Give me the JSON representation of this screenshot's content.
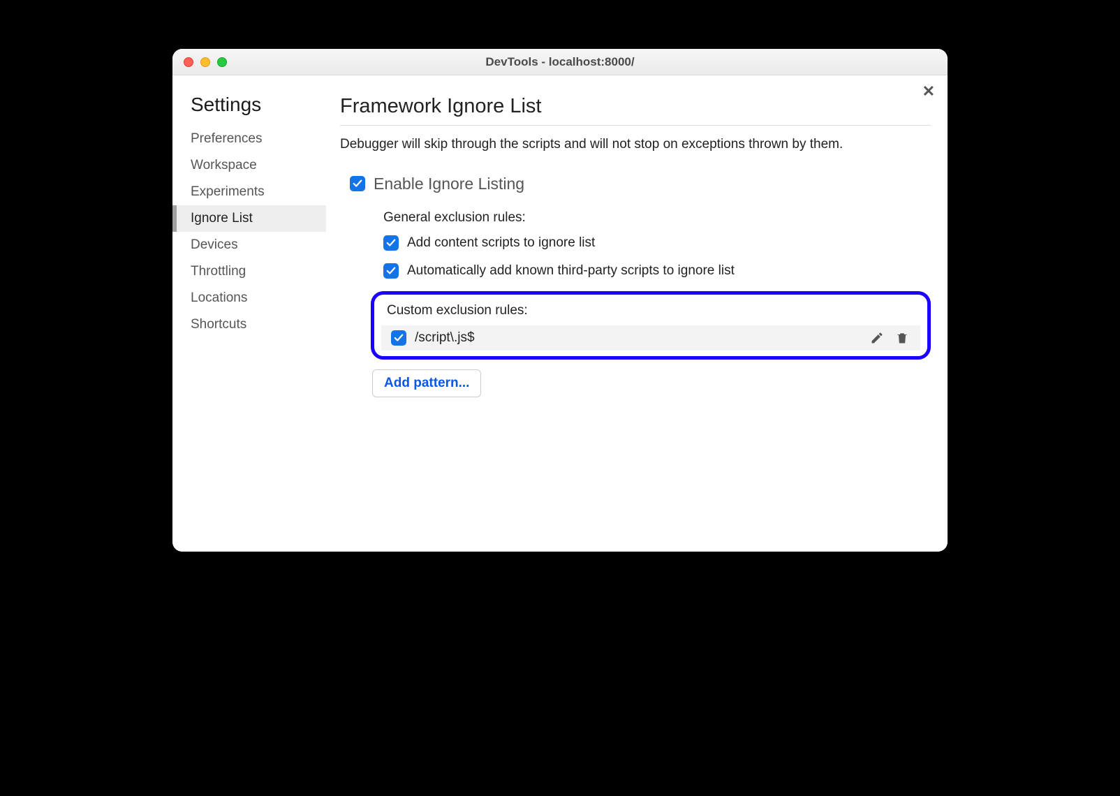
{
  "window_title": "DevTools - localhost:8000/",
  "sidebar": {
    "title": "Settings",
    "items": [
      {
        "label": "Preferences"
      },
      {
        "label": "Workspace"
      },
      {
        "label": "Experiments"
      },
      {
        "label": "Ignore List",
        "active": true
      },
      {
        "label": "Devices"
      },
      {
        "label": "Throttling"
      },
      {
        "label": "Locations"
      },
      {
        "label": "Shortcuts"
      }
    ]
  },
  "panel": {
    "title": "Framework Ignore List",
    "description": "Debugger will skip through the scripts and will not stop on exceptions thrown by them.",
    "enable_label": "Enable Ignore Listing",
    "enable_checked": true,
    "general_heading": "General exclusion rules:",
    "general_rules": [
      {
        "label": "Add content scripts to ignore list",
        "checked": true
      },
      {
        "label": "Automatically add known third-party scripts to ignore list",
        "checked": true
      }
    ],
    "custom_heading": "Custom exclusion rules:",
    "custom_rules": [
      {
        "pattern": "/script\\.js$",
        "checked": true
      }
    ],
    "add_pattern_label": "Add pattern..."
  }
}
